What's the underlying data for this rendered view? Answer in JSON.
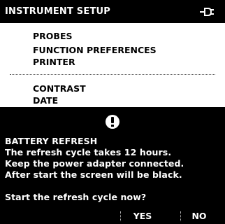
{
  "header": {
    "title": "INSTRUMENT SETUP",
    "status_icon": "power-plug-icon"
  },
  "menu": {
    "items": [
      {
        "label": "PROBES"
      },
      {
        "label": "FUNCTION PREFERENCES"
      },
      {
        "label": "PRINTER"
      },
      {
        "label": "CONTRAST"
      },
      {
        "label": "DATE"
      }
    ]
  },
  "dialog": {
    "icon": "exclamation-icon",
    "title": "BATTERY REFRESH",
    "lines": [
      "The refresh cycle takes 12 hours.",
      "Keep the power adapter connected.",
      "After start the screen will be black."
    ],
    "question": "Start the refresh cycle now?",
    "yes_label": "YES",
    "no_label": "NO"
  },
  "colors": {
    "background": "#000000",
    "foreground": "#ffffff",
    "menu_background": "#ffffff"
  }
}
